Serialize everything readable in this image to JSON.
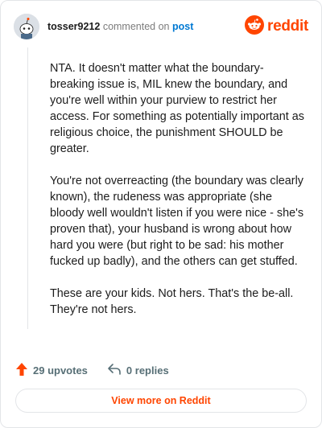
{
  "header": {
    "username": "tosser9212",
    "commented_on": "commented on",
    "post_link": "post",
    "brand": "reddit"
  },
  "comment": {
    "paragraphs": [
      "NTA. It doesn't matter what the boundary-breaking issue is, MIL knew the boundary, and you're well within your purview to restrict her access. For something as potentially important as religious choice, the punishment SHOULD be greater.",
      "You're not overreacting (the boundary was clearly known), the rudeness was appropriate (she bloody well wouldn't listen if you were nice - she's proven that), your husband is wrong about how hard you were (but right to be sad: his mother fucked up badly), and the others can get stuffed.",
      "These are your kids. Not hers. That's the be-all. They're not hers."
    ]
  },
  "actions": {
    "upvotes": "29 upvotes",
    "replies": "0 replies"
  },
  "footer": {
    "view_more": "View more on Reddit"
  },
  "colors": {
    "brand": "#ff4500",
    "link": "#0079d3",
    "muted": "#7c7c7c",
    "border": "#e3e5e8"
  },
  "icons": {
    "avatar": "snoo-avatar-icon",
    "logo": "reddit-logo-icon",
    "upvote": "upvote-arrow-icon",
    "reply": "reply-arrow-icon"
  }
}
